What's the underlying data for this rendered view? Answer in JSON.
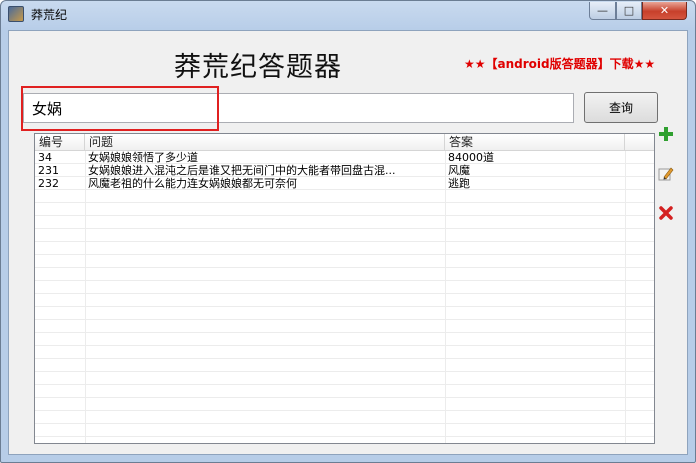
{
  "window": {
    "title": "莽荒纪",
    "controls": {
      "minimize": "—",
      "maximize": "□",
      "close": "✕"
    }
  },
  "header": {
    "app_title": "莽荒纪答题器",
    "download_link": "★★【android版答题器】下载★★"
  },
  "search": {
    "value": "女娲",
    "button_label": "查询"
  },
  "table": {
    "columns": [
      "编号",
      "问题",
      "答案"
    ],
    "rows": [
      {
        "id": "34",
        "question": "女娲娘娘领悟了多少道",
        "answer": "84000道"
      },
      {
        "id": "231",
        "question": "女娲娘娘进入混沌之后是谁又把无间门中的大能者带回盘古混...",
        "answer": "风魔"
      },
      {
        "id": "232",
        "question": "风魔老祖的什么能力连女娲娘娘都无可奈何",
        "answer": "逃跑"
      }
    ]
  },
  "side_tools": {
    "add": "add-icon",
    "edit": "edit-icon",
    "delete": "delete-icon"
  },
  "colors": {
    "accent_red": "#e00000",
    "add_green": "#2fa02f",
    "delete_red": "#d42020"
  }
}
